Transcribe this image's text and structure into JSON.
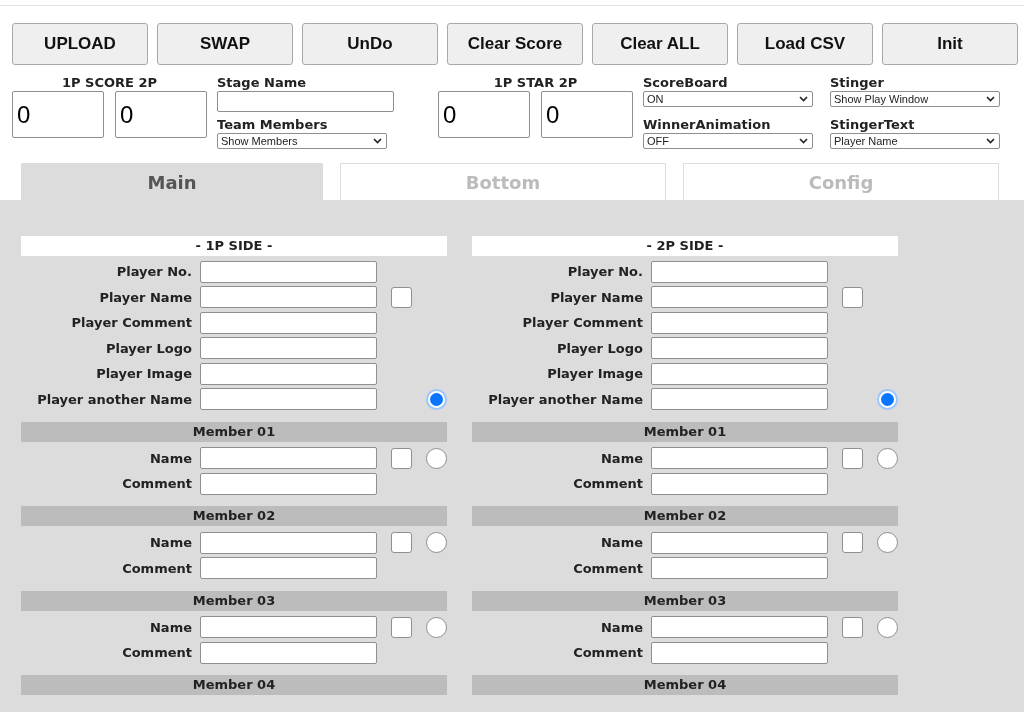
{
  "toolbar": {
    "buttons": [
      "UPLOAD",
      "SWAP",
      "UnDo",
      "Clear Score",
      "Clear ALL",
      "Load CSV",
      "Init"
    ]
  },
  "score": {
    "label": "1P SCORE 2P",
    "p1": "0",
    "p2": "0"
  },
  "stage_name": {
    "label": "Stage Name"
  },
  "team_members": {
    "label": "Team Members",
    "value": "Show Members"
  },
  "star": {
    "label": "1P STAR 2P",
    "p1": "0",
    "p2": "0"
  },
  "select_columns": [
    [
      {
        "label": "ScoreBoard",
        "value": "ON"
      },
      {
        "label": "WinnerAnimation",
        "value": "OFF"
      }
    ],
    [
      {
        "label": "Stinger",
        "value": "Show Play Window"
      },
      {
        "label": "StingerText",
        "value": "Player Name"
      }
    ]
  ],
  "tabs": [
    {
      "label": "Main",
      "selected": true
    },
    {
      "label": "Bottom",
      "selected": false
    },
    {
      "label": "Config",
      "selected": false
    }
  ],
  "sides": [
    {
      "title": "- 1P SIDE -",
      "fields": [
        {
          "label": "Player No.",
          "kind": "plain"
        },
        {
          "label": "Player Name",
          "kind": "checkbox",
          "checked": false
        },
        {
          "label": "Player Comment",
          "kind": "plain"
        },
        {
          "label": "Player Logo",
          "kind": "plain"
        },
        {
          "label": "Player Image",
          "kind": "plain"
        },
        {
          "label": "Player another Name",
          "kind": "radio",
          "selected": true
        }
      ],
      "members": [
        {
          "title": "Member 01",
          "name_label": "Name",
          "comment_label": "Comment",
          "checked": false,
          "selected": false
        },
        {
          "title": "Member 02",
          "name_label": "Name",
          "comment_label": "Comment",
          "checked": false,
          "selected": false
        },
        {
          "title": "Member 03",
          "name_label": "Name",
          "comment_label": "Comment",
          "checked": false,
          "selected": false
        },
        {
          "title": "Member 04"
        }
      ]
    },
    {
      "title": "- 2P SIDE -",
      "fields": [
        {
          "label": "Player No.",
          "kind": "plain"
        },
        {
          "label": "Player Name",
          "kind": "checkbox",
          "checked": false
        },
        {
          "label": "Player Comment",
          "kind": "plain"
        },
        {
          "label": "Player Logo",
          "kind": "plain"
        },
        {
          "label": "Player Image",
          "kind": "plain"
        },
        {
          "label": "Player another Name",
          "kind": "radio",
          "selected": true
        }
      ],
      "members": [
        {
          "title": "Member 01",
          "name_label": "Name",
          "comment_label": "Comment",
          "checked": false,
          "selected": false
        },
        {
          "title": "Member 02",
          "name_label": "Name",
          "comment_label": "Comment",
          "checked": false,
          "selected": false
        },
        {
          "title": "Member 03",
          "name_label": "Name",
          "comment_label": "Comment",
          "checked": false,
          "selected": false
        },
        {
          "title": "Member 04"
        }
      ]
    }
  ]
}
